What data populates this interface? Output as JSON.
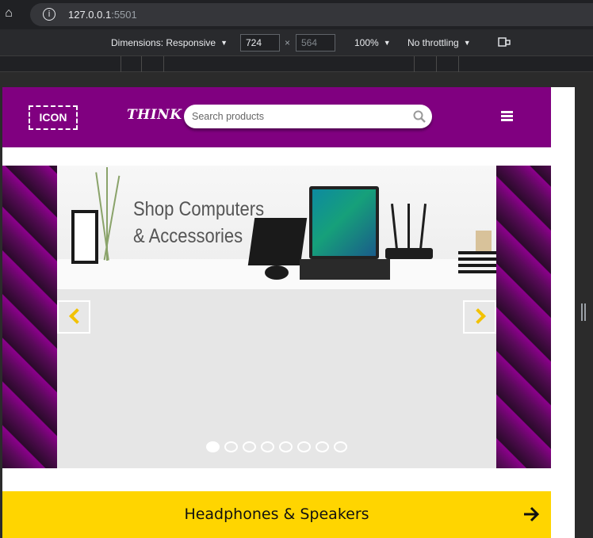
{
  "browser": {
    "url_host": "127.0.0.1",
    "url_port": ":5501"
  },
  "device_toolbar": {
    "dimensions_label": "Dimensions: Responsive",
    "width": "724",
    "height": "564",
    "zoom": "100%",
    "throttling": "No throttling"
  },
  "header": {
    "logo_text": "ICON",
    "brand": "THINK",
    "search_placeholder": "Search products"
  },
  "carousel": {
    "banner_line1": "Shop Computers",
    "banner_line2": "& Accessories",
    "slide_count": 8,
    "active_slide": 1
  },
  "category": {
    "label": "Headphones & Speakers"
  },
  "colors": {
    "header_bg": "#800080",
    "accent_yellow": "#ffd500",
    "arrow_yellow": "#f2c200"
  }
}
